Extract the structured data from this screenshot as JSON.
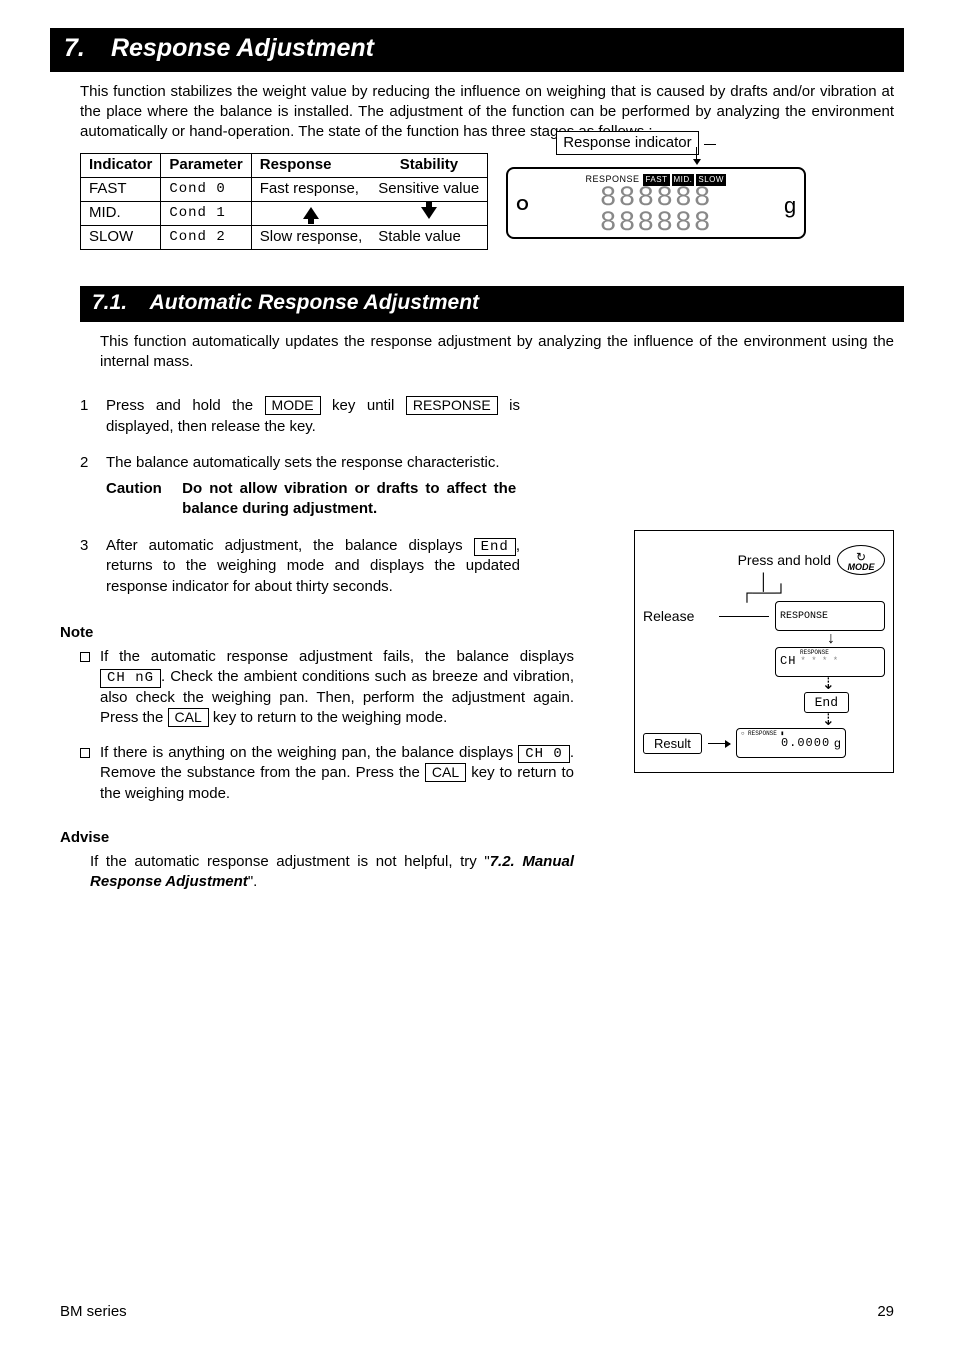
{
  "title": {
    "num": "7.",
    "text": "Response Adjustment"
  },
  "intro": "This function stabilizes the weight value by reducing the influence on weighing that is caused by drafts and/or vibration at the place where the balance is installed. The adjustment of the function can be performed by analyzing the environment automatically or hand-operation. The state of the function has three stages as follows :",
  "table": {
    "headers": [
      "Indicator",
      "Parameter",
      "Response",
      "Stability"
    ],
    "rows": [
      {
        "ind": "FAST",
        "param": "Cond 0",
        "resp": "Fast response,",
        "stab": "Sensitive value"
      },
      {
        "ind": "MID.",
        "param": "Cond 1",
        "resp": "",
        "stab": ""
      },
      {
        "ind": "SLOW",
        "param": "Cond 2",
        "resp": "Slow response,",
        "stab": "Stable value"
      }
    ]
  },
  "resp_indicator": {
    "label": "Response indicator",
    "response_word": "RESPONSE",
    "tags": [
      "FAST",
      "MID.",
      "SLOW"
    ],
    "o": "O",
    "g": "g"
  },
  "sub": {
    "num": "7.1.",
    "text": "Automatic Response Adjustment"
  },
  "sub_intro": "This function automatically updates the response adjustment by analyzing the influence of the environment using the internal mass.",
  "steps": {
    "s1a": "Press and hold the ",
    "s1_key1": " MODE ",
    "s1b": " key until ",
    "s1_key2": " RESPONSE ",
    "s1c": " is displayed, then release the key.",
    "s2": "The balance automatically sets the response characteristic.",
    "caution_label": "Caution",
    "caution_text": "Do not allow vibration or drafts to affect the balance during adjustment.",
    "s3a": "After automatic adjustment, the balance displays ",
    "s3_key": " End ",
    "s3b": ", returns to the weighing mode and displays the updated response indicator for about thirty seconds."
  },
  "note": {
    "heading": "Note",
    "b1a": "If the automatic response adjustment fails, the balance displays ",
    "b1_key": " CH nG ",
    "b1b": ". Check the ambient conditions such as breeze and vibration, also check the weighing pan. Then, perform the adjustment again. Press the ",
    "b1_key2": " CAL ",
    "b1c": " key to return to the weighing mode.",
    "b2a": "If there is anything on the weighing pan, the balance displays ",
    "b2_key": " CH 0 ",
    "b2b": ". Remove the substance from the pan. Press the ",
    "b2_key2": " CAL ",
    "b2c": " key to return to the weighing mode."
  },
  "advise": {
    "heading": "Advise",
    "a": "If the automatic response adjustment is not helpful, try \"",
    "ref": "7.2. Manual Response Adjustment",
    "b": "\"."
  },
  "diagram": {
    "press_hold": "Press and hold",
    "mode": "MODE",
    "release": "Release",
    "ch": "CH",
    "resp_tiny": "RESPONSE",
    "end": "End",
    "result": "Result",
    "zeros": "0.0000",
    "g": "g"
  },
  "footer": {
    "left": "BM series",
    "right": "29"
  }
}
